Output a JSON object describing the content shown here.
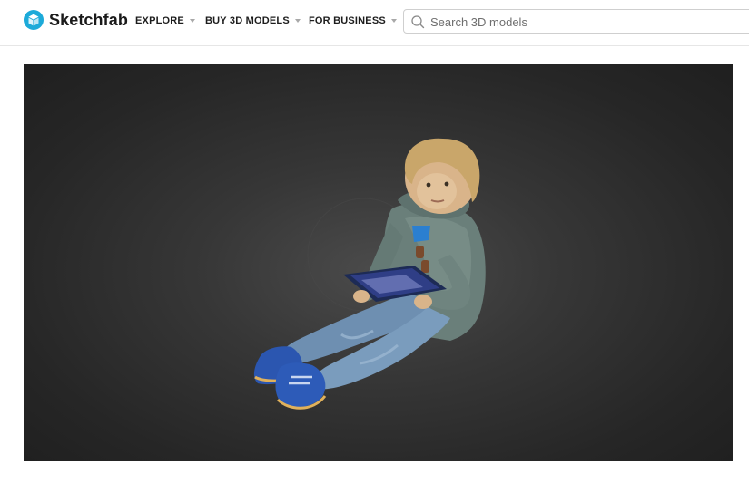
{
  "brand": {
    "name": "Sketchfab",
    "color": "#1caad9",
    "icon": "sketchfab-logo-icon"
  },
  "nav": {
    "items": [
      {
        "label": "EXPLORE",
        "icon": "caret-down-icon"
      },
      {
        "label": "BUY 3D MODELS",
        "icon": "caret-down-icon"
      },
      {
        "label": "FOR BUSINESS",
        "icon": "caret-down-icon"
      }
    ]
  },
  "search": {
    "placeholder": "Search 3D models",
    "value": "",
    "icon": "search-icon"
  },
  "viewer": {
    "subject": "3D scan: young child sitting holding a tablet",
    "background": "#262626"
  }
}
